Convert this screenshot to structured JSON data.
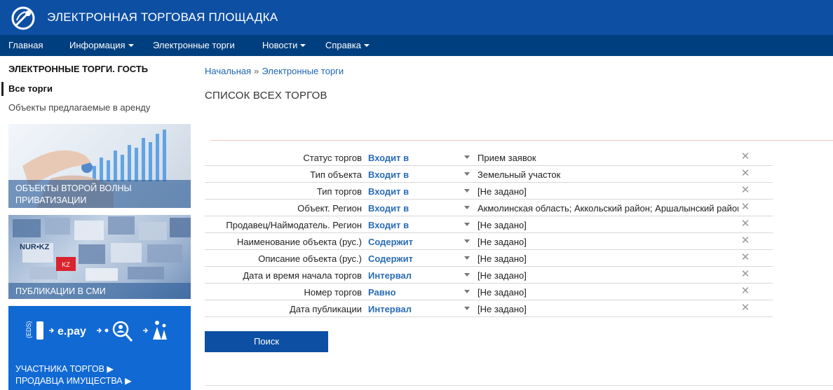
{
  "header": {
    "title": "ЭЛЕКТРОННАЯ ТОРГОВАЯ ПЛОЩАДКА",
    "logo_icon": "logo-icon",
    "bg_color": "#0d4fa3"
  },
  "nav": {
    "items": [
      {
        "label": "Главная",
        "has_dropdown": false
      },
      {
        "label": "Информация",
        "has_dropdown": true
      },
      {
        "label": "Электронные торги",
        "has_dropdown": false
      },
      {
        "label": "Новости",
        "has_dropdown": true
      },
      {
        "label": "Справка",
        "has_dropdown": true
      }
    ],
    "bg_color": "#003f7f"
  },
  "sidebar": {
    "title": "ЭЛЕКТРОННЫЕ ТОРГИ. ГОСТЬ",
    "active_item": "Все торги",
    "link": "Объекты предлагаемые в аренду",
    "banners": [
      {
        "caption_line1": "ОБЪЕКТЫ ВТОРОЙ ВОЛНЫ",
        "caption_line2": "ПРИВАТИЗАЦИИ"
      },
      {
        "caption_line1": "ПУБЛИКАЦИИ В СМИ",
        "logo_text": "NUR•KZ"
      },
      {
        "caption_line1": "УЧАСТНИКА ТОРГОВ ▶",
        "caption_line2": "ПРОДАВЦА ИМУЩЕСТВА ▶",
        "eds_label": "EDS",
        "epay_label": "e.pay"
      }
    ]
  },
  "breadcrumb": {
    "home": "Начальная",
    "separator": "»",
    "current": "Электронные торги"
  },
  "page_title": "СПИСОК ВСЕХ ТОРГОВ",
  "filters": [
    {
      "label": "Статус торгов",
      "operator": "Входит в",
      "value": "Прием заявок"
    },
    {
      "label": "Тип объекта",
      "operator": "Входит в",
      "value": "Земельный участок"
    },
    {
      "label": "Тип торгов",
      "operator": "Входит в",
      "value": "[Не задано]"
    },
    {
      "label": "Объект. Регион",
      "operator": "Входит в",
      "value": "Акмолинская область; Аккольский район; Аршалынский район"
    },
    {
      "label": "Продавец/Наймодатель. Регион",
      "operator": "Входит в",
      "value": "[Не задано]"
    },
    {
      "label": "Наименование объекта (рус.)",
      "operator": "Содержит",
      "value": "[Не задано]"
    },
    {
      "label": "Описание объекта (рус.)",
      "operator": "Содержит",
      "value": "[Не задано]"
    },
    {
      "label": "Дата и время начала торгов",
      "operator": "Интервал",
      "value": "[Не задано]"
    },
    {
      "label": "Номер торгов",
      "operator": "Равно",
      "value": "[Не задано]"
    },
    {
      "label": "Дата публикации",
      "operator": "Интервал",
      "value": "[Не задано]"
    }
  ],
  "filter_clear_icon": "close-icon",
  "search_button": "Поиск",
  "accent_color": "#2a6db5"
}
